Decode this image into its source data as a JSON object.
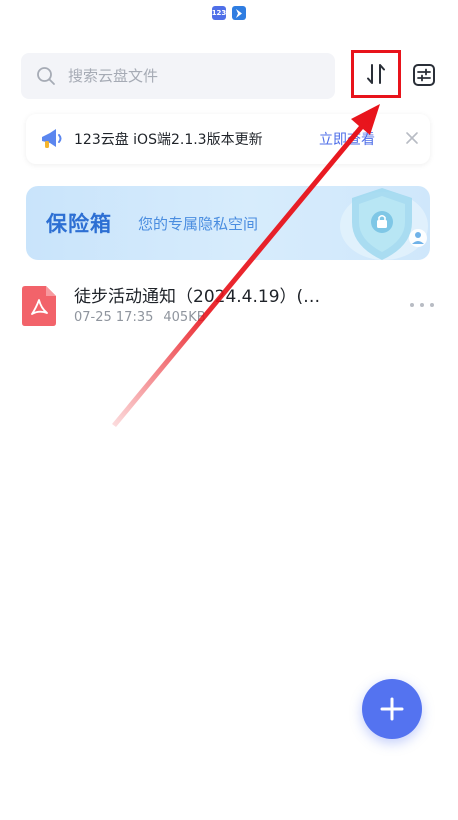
{
  "status_bar": {
    "app_badge": "123"
  },
  "search": {
    "placeholder": "搜索云盘文件",
    "value": ""
  },
  "toolbar": {
    "sort_icon": "sort-icon",
    "filter_icon": "filter-icon"
  },
  "notice": {
    "text": "123云盘 iOS端2.1.3版本更新",
    "link": "立即查看"
  },
  "vault": {
    "title": "保险箱",
    "subtitle": "您的专属隐私空间"
  },
  "files": [
    {
      "name": "徒步活动通知（2024.4.19）(…",
      "date": "07-25 17:35",
      "size": "405KB",
      "type": "pdf"
    }
  ],
  "colors": {
    "accent": "#5473f0",
    "annotation": "#e8131b",
    "pdf": "#f2636a"
  }
}
